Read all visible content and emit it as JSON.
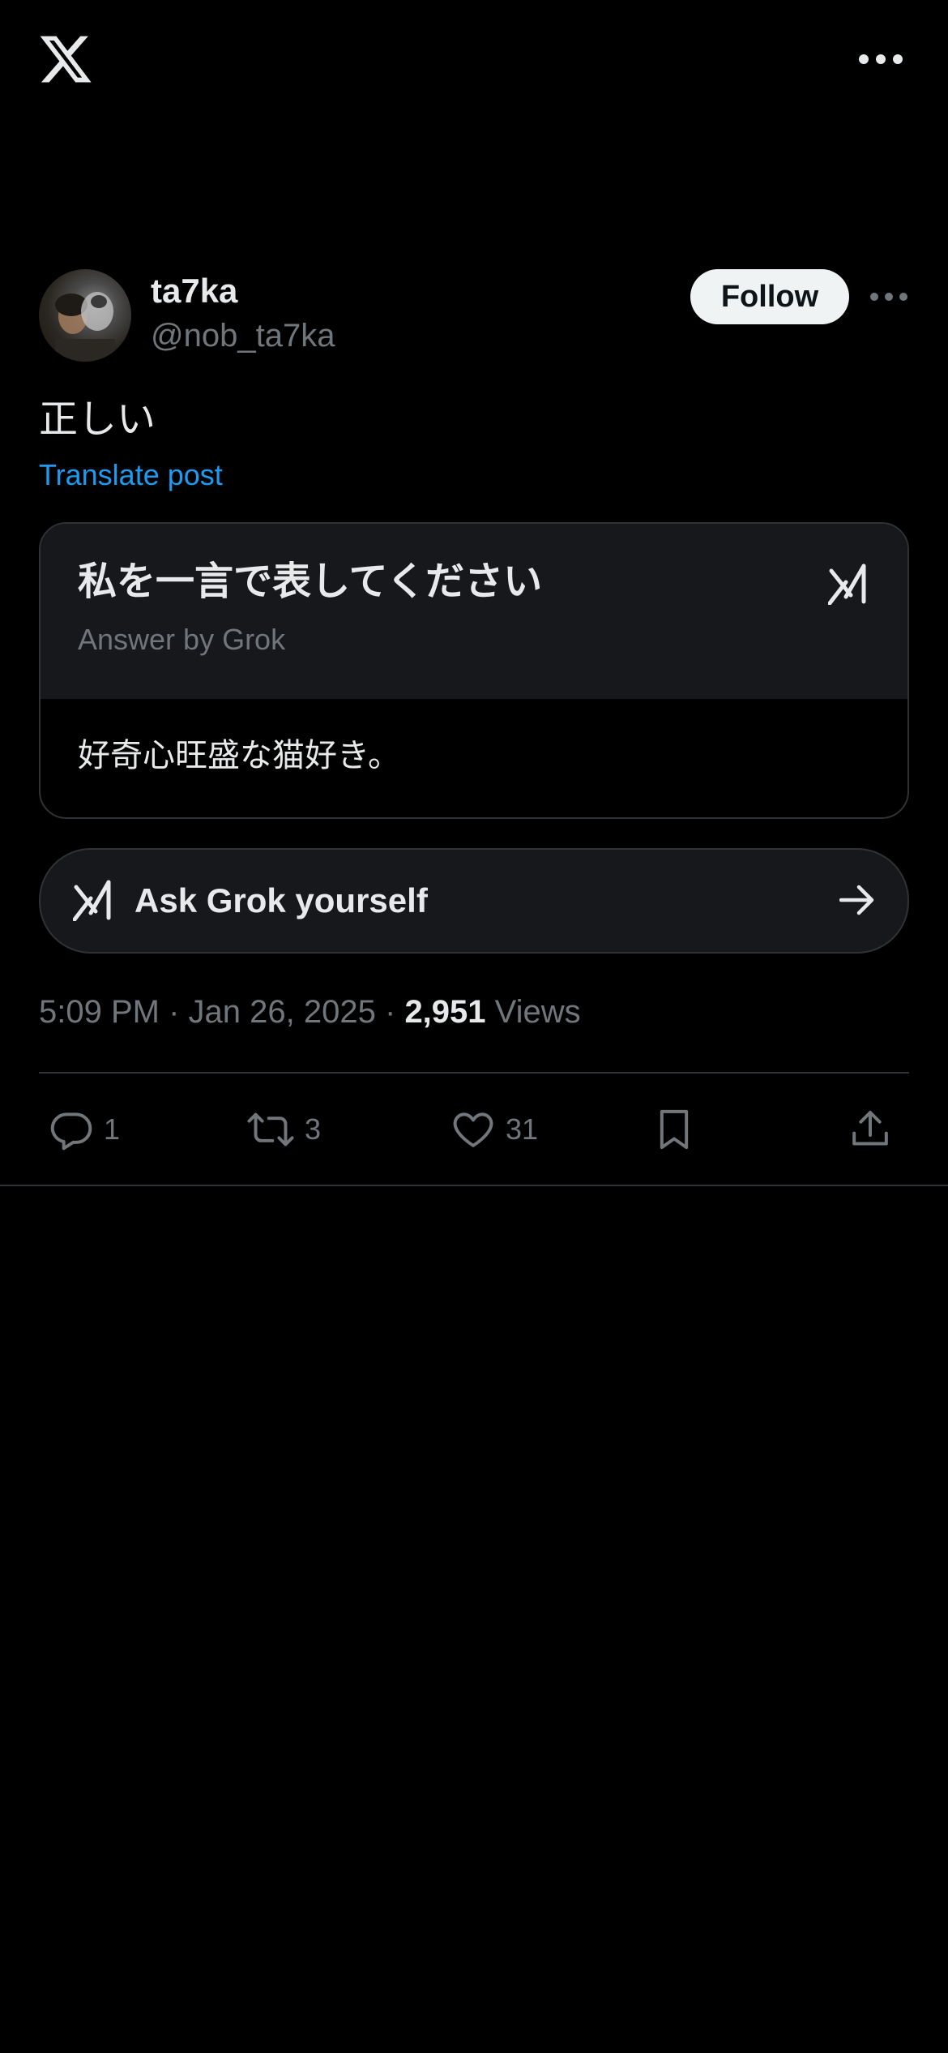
{
  "topbar": {
    "logo_icon": "x-logo-icon",
    "more_icon": "more-horizontal-icon"
  },
  "post": {
    "author": {
      "display_name": "ta7ka",
      "handle": "@nob_ta7ka",
      "avatar_icon": "avatar-photo"
    },
    "follow_label": "Follow",
    "text": "正しい",
    "translate_label": "Translate post",
    "grok_card": {
      "question": "私を一言で表してください",
      "answer_by": "Answer by Grok",
      "answer": "好奇心旺盛な猫好き。",
      "logo_icon": "grok-logo-icon"
    },
    "ask_grok": {
      "label": "Ask Grok yourself",
      "arrow_icon": "arrow-right-icon"
    },
    "meta": {
      "time": "5:09 PM",
      "separator": "·",
      "date": "Jan 26, 2025",
      "views_count": "2,951",
      "views_label": "Views"
    },
    "actions": {
      "reply_count": "1",
      "repost_count": "3",
      "like_count": "31"
    }
  },
  "colors": {
    "background": "#000000",
    "text_primary": "#e7e9ea",
    "text_secondary": "#71767b",
    "accent_link": "#1d9bf0",
    "border": "#2f3336",
    "card_header": "#16181c",
    "follow_bg": "#eff3f4"
  }
}
